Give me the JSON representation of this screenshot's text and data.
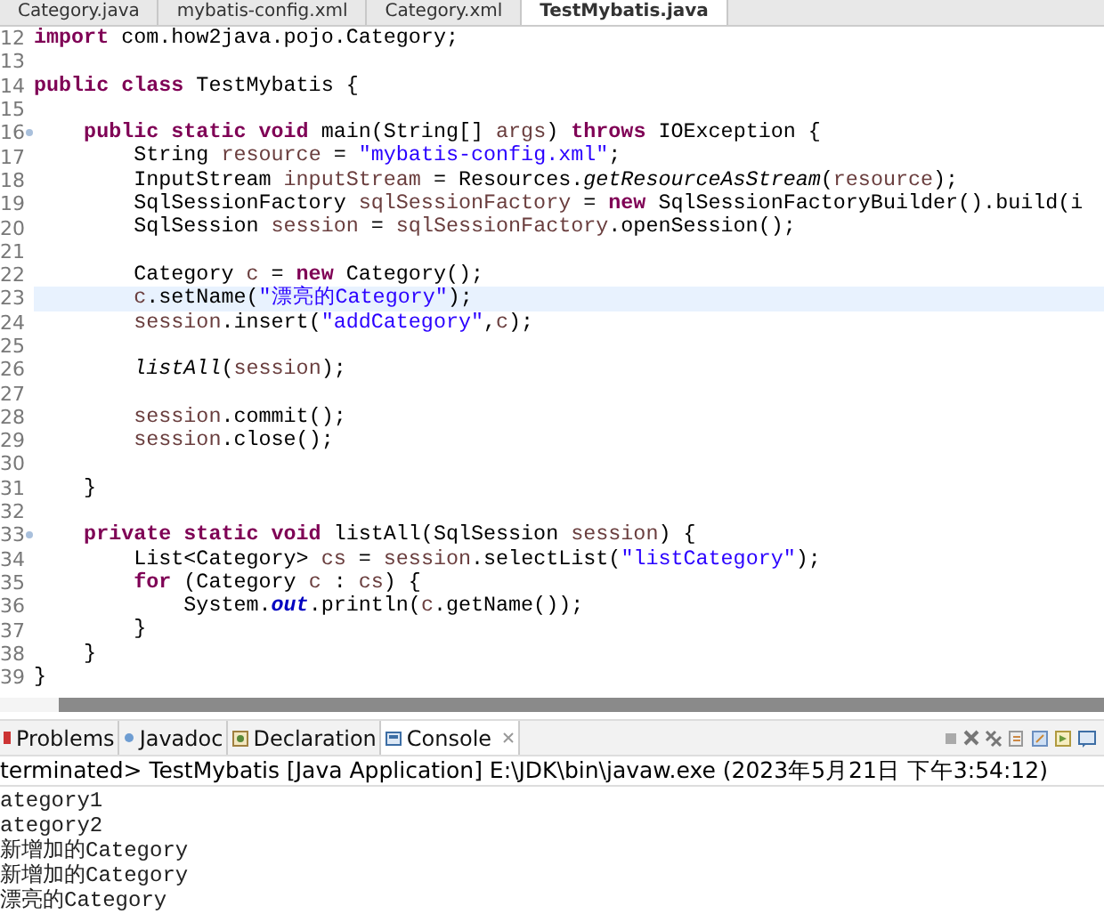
{
  "editor_tabs": [
    {
      "label": "Category.java",
      "selected": false
    },
    {
      "label": "mybatis-config.xml",
      "selected": false
    },
    {
      "label": "Category.xml",
      "selected": false
    },
    {
      "label": "TestMybatis.java",
      "selected": true
    }
  ],
  "code_lines": [
    {
      "no": "12",
      "segs": [
        {
          "kind": "kw",
          "t": "import"
        },
        {
          "kind": "plain",
          "t": " com.how2java.pojo.Category;"
        }
      ]
    },
    {
      "no": "13"
    },
    {
      "no": "14",
      "segs": [
        {
          "kind": "kw",
          "t": "public class"
        },
        {
          "kind": "plain",
          "t": " TestMybatis {"
        }
      ]
    },
    {
      "no": "15"
    },
    {
      "no": "16",
      "fold": true,
      "segs": [
        {
          "kind": "kw",
          "t": "    public static void"
        },
        {
          "kind": "plain",
          "t": " main(String[] "
        },
        {
          "kind": "var",
          "t": "args"
        },
        {
          "kind": "plain",
          "t": ") "
        },
        {
          "kind": "kw",
          "t": "throws"
        },
        {
          "kind": "plain",
          "t": " IOException {"
        }
      ]
    },
    {
      "no": "17",
      "segs": [
        {
          "kind": "plain",
          "t": "        String "
        },
        {
          "kind": "var",
          "t": "resource"
        },
        {
          "kind": "plain",
          "t": " = "
        },
        {
          "kind": "str",
          "t": "\"mybatis-config.xml\""
        },
        {
          "kind": "plain",
          "t": ";"
        }
      ]
    },
    {
      "no": "18",
      "segs": [
        {
          "kind": "plain",
          "t": "        InputStream "
        },
        {
          "kind": "var",
          "t": "inputStream"
        },
        {
          "kind": "plain",
          "t": " = Resources."
        },
        {
          "kind": "static",
          "t": "getResourceAsStream"
        },
        {
          "kind": "plain",
          "t": "("
        },
        {
          "kind": "var",
          "t": "resource"
        },
        {
          "kind": "plain",
          "t": ");"
        }
      ]
    },
    {
      "no": "19",
      "segs": [
        {
          "kind": "plain",
          "t": "        SqlSessionFactory "
        },
        {
          "kind": "var",
          "t": "sqlSessionFactory"
        },
        {
          "kind": "plain",
          "t": " = "
        },
        {
          "kind": "kw",
          "t": "new"
        },
        {
          "kind": "plain",
          "t": " SqlSessionFactoryBuilder().build(i"
        }
      ]
    },
    {
      "no": "20",
      "segs": [
        {
          "kind": "plain",
          "t": "        SqlSession "
        },
        {
          "kind": "var",
          "t": "session"
        },
        {
          "kind": "plain",
          "t": " = "
        },
        {
          "kind": "var",
          "t": "sqlSessionFactory"
        },
        {
          "kind": "plain",
          "t": ".openSession();"
        }
      ]
    },
    {
      "no": "21"
    },
    {
      "no": "22",
      "segs": [
        {
          "kind": "plain",
          "t": "        Category "
        },
        {
          "kind": "var",
          "t": "c"
        },
        {
          "kind": "plain",
          "t": " = "
        },
        {
          "kind": "kw",
          "t": "new"
        },
        {
          "kind": "plain",
          "t": " Category();"
        }
      ]
    },
    {
      "no": "23",
      "current": true,
      "segs": [
        {
          "kind": "var",
          "t": "        c"
        },
        {
          "kind": "plain",
          "t": ".setName("
        },
        {
          "kind": "str",
          "t": "\"漂亮的Category\""
        },
        {
          "kind": "plain",
          "t": ");"
        }
      ]
    },
    {
      "no": "24",
      "segs": [
        {
          "kind": "var",
          "t": "        session"
        },
        {
          "kind": "plain",
          "t": ".insert("
        },
        {
          "kind": "str",
          "t": "\"addCategory\""
        },
        {
          "kind": "plain",
          "t": ","
        },
        {
          "kind": "var",
          "t": "c"
        },
        {
          "kind": "plain",
          "t": ");"
        }
      ]
    },
    {
      "no": "25"
    },
    {
      "no": "26",
      "segs": [
        {
          "kind": "static",
          "t": "        listAll"
        },
        {
          "kind": "plain",
          "t": "("
        },
        {
          "kind": "var",
          "t": "session"
        },
        {
          "kind": "plain",
          "t": ");"
        }
      ]
    },
    {
      "no": "27"
    },
    {
      "no": "28",
      "segs": [
        {
          "kind": "var",
          "t": "        session"
        },
        {
          "kind": "plain",
          "t": ".commit();"
        }
      ]
    },
    {
      "no": "29",
      "segs": [
        {
          "kind": "var",
          "t": "        session"
        },
        {
          "kind": "plain",
          "t": ".close();"
        }
      ]
    },
    {
      "no": "30"
    },
    {
      "no": "31",
      "segs": [
        {
          "kind": "plain",
          "t": "    }"
        }
      ]
    },
    {
      "no": "32"
    },
    {
      "no": "33",
      "fold": true,
      "segs": [
        {
          "kind": "kw",
          "t": "    private static void"
        },
        {
          "kind": "plain",
          "t": " listAll(SqlSession "
        },
        {
          "kind": "var",
          "t": "session"
        },
        {
          "kind": "plain",
          "t": ") {"
        }
      ]
    },
    {
      "no": "34",
      "segs": [
        {
          "kind": "plain",
          "t": "        List<Category> "
        },
        {
          "kind": "var",
          "t": "cs"
        },
        {
          "kind": "plain",
          "t": " = "
        },
        {
          "kind": "var",
          "t": "session"
        },
        {
          "kind": "plain",
          "t": ".selectList("
        },
        {
          "kind": "str",
          "t": "\"listCategory\""
        },
        {
          "kind": "plain",
          "t": ");"
        }
      ]
    },
    {
      "no": "35",
      "segs": [
        {
          "kind": "kw",
          "t": "        for"
        },
        {
          "kind": "plain",
          "t": " (Category "
        },
        {
          "kind": "var",
          "t": "c"
        },
        {
          "kind": "plain",
          "t": " : "
        },
        {
          "kind": "var",
          "t": "cs"
        },
        {
          "kind": "plain",
          "t": ") {"
        }
      ]
    },
    {
      "no": "36",
      "segs": [
        {
          "kind": "plain",
          "t": "            System."
        },
        {
          "kind": "field",
          "t": "out"
        },
        {
          "kind": "plain",
          "t": ".println("
        },
        {
          "kind": "var",
          "t": "c"
        },
        {
          "kind": "plain",
          "t": ".getName());"
        }
      ]
    },
    {
      "no": "37",
      "segs": [
        {
          "kind": "plain",
          "t": "        }"
        }
      ]
    },
    {
      "no": "38",
      "segs": [
        {
          "kind": "plain",
          "t": "    }"
        }
      ]
    },
    {
      "no": "39",
      "segs": [
        {
          "kind": "plain",
          "t": "}"
        }
      ]
    }
  ],
  "console": {
    "tabs": [
      {
        "label": "Problems",
        "selected": false
      },
      {
        "label": "Javadoc",
        "selected": false
      },
      {
        "label": "Declaration",
        "selected": false
      },
      {
        "label": "Console",
        "selected": true
      }
    ],
    "status": "terminated> TestMybatis [Java Application] E:\\JDK\\bin\\javaw.exe (2023年5月21日 下午3:54:12)",
    "output": [
      "ategory1",
      "ategory2",
      "新增加的Category",
      "新增加的Category",
      "漂亮的Category"
    ]
  }
}
